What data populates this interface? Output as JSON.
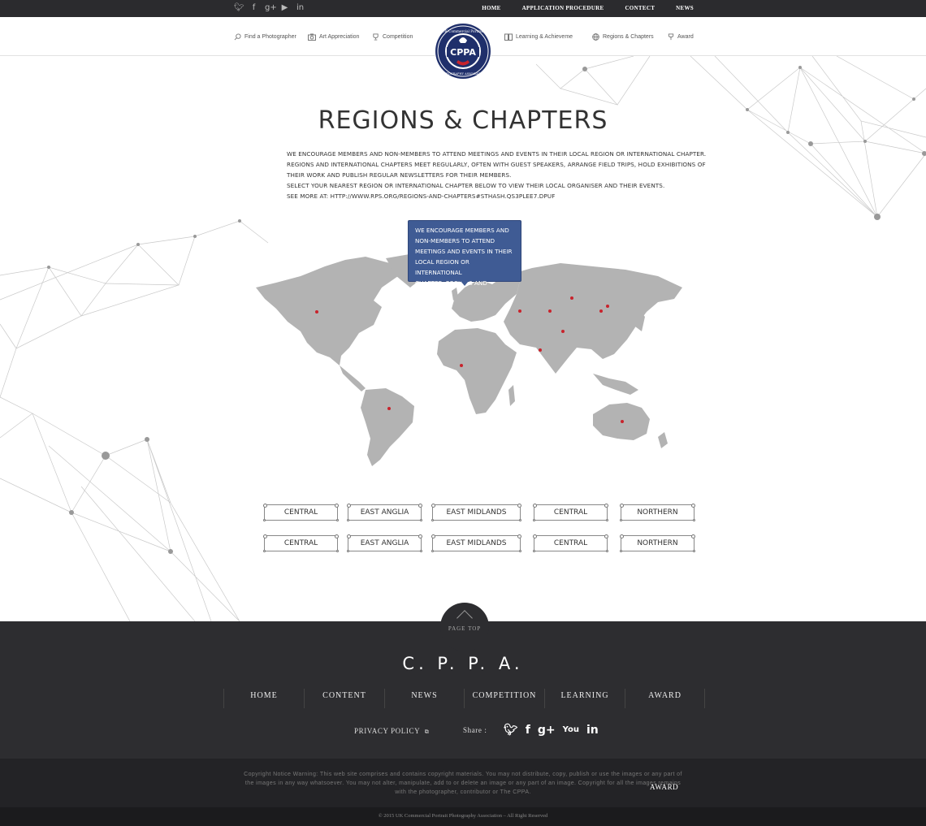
{
  "topbar": {
    "social_icons": [
      "twitter-icon",
      "facebook-icon",
      "google-plus-icon",
      "youtube-icon",
      "linkedin-icon"
    ],
    "nav": [
      "HOME",
      "APPLICATION PROCEDURE",
      "CONTECT",
      "NEWS"
    ]
  },
  "subnav": {
    "left": [
      {
        "label": "Find a Photographer",
        "icon": "search-icon"
      },
      {
        "label": "Art Appreciation",
        "icon": "camera-icon"
      },
      {
        "label": "Competition",
        "icon": "trophy-icon"
      }
    ],
    "right": [
      {
        "label": "Learning & Achieveme",
        "icon": "book-icon"
      },
      {
        "label": "Regions & Chapters",
        "icon": "globe-icon"
      },
      {
        "label": "Award",
        "icon": "award-icon"
      }
    ]
  },
  "logo": {
    "text": "CPPA",
    "ring_top": "UK Commercial Portrait",
    "ring_bottom": "PHOTOGRAPHY ASSOCIATION",
    "colors": {
      "navy": "#1f2f6b",
      "red": "#c8232c",
      "white": "#ffffff"
    }
  },
  "page": {
    "title": "REGIONS & CHAPTERS",
    "description": [
      "WE ENCOURAGE MEMBERS AND NON-MEMBERS TO ATTEND MEETINGS AND EVENTS IN THEIR LOCAL REGION OR INTERNATIONAL CHAPTER.",
      "REGIONS AND INTERNATIONAL CHAPTERS MEET REGULARLY, OFTEN WITH GUEST SPEAKERS, ARRANGE FIELD TRIPS, HOLD EXHIBITIONS OF",
      "THEIR WORK AND PUBLISH REGULAR NEWSLETTERS FOR THEIR MEMBERS.",
      "SELECT YOUR NEAREST REGION OR INTERNATIONAL CHAPTER BELOW TO VIEW THEIR LOCAL ORGANISER AND THEIR EVENTS.",
      " SEE MORE AT: HTTP://WWW.RPS.ORG/REGIONS-AND-CHAPTERS#STHASH.QS3PLEE7.DPUF"
    ]
  },
  "tooltip": {
    "lines": [
      "WE ENCOURAGE MEMBERS AND",
      "NON-MEMBERS TO ATTEND",
      "MEETINGS AND EVENTS IN THEIR",
      "LOCAL REGION OR INTERNATIONAL",
      "CHAPTER. REGIONS AND"
    ],
    "color": "#3f5b94"
  },
  "map": {
    "land_color": "#b3b3b3",
    "marker_color": "#c8232c",
    "marker_count": 13
  },
  "regions": {
    "row1": [
      "CENTRAL",
      "EAST ANGLIA",
      "EAST MIDLANDS",
      "CENTRAL",
      "NORTHERN"
    ],
    "row2": [
      "CENTRAL",
      "EAST ANGLIA",
      "EAST MIDLANDS",
      "CENTRAL",
      "NORTHERN"
    ]
  },
  "footer": {
    "page_top": "PAGE TOP",
    "brand": "C. P. P. A.",
    "nav": [
      "HOME",
      "CONTENT",
      "NEWS",
      "COMPETITION",
      "LEARNING",
      "AWARD"
    ],
    "privacy": "PRIVACY POLICY",
    "share_label": "Share :",
    "share_icons": [
      "twitter-icon",
      "facebook-icon",
      "google-plus-icon",
      "youtube-icon",
      "linkedin-icon"
    ],
    "copyright": "Copyright Notice Warning: This web site comprises and contains copyright materials. You may not distribute, copy, publish or use the images or any part of the images in any way whatsoever. You may not alter, manipulate, add to or delete an image or any part of an image. Copyright for all the images remains with the photographer, contributor or The CPPA.",
    "award_label": "AWARD",
    "bottom": "© 2015 UK Commercial Portrait Photography Association – All Right Reserved",
    "colors": {
      "footer": "#2d2d30",
      "copyright": "#232326",
      "bottom": "#1b1b1d"
    }
  }
}
